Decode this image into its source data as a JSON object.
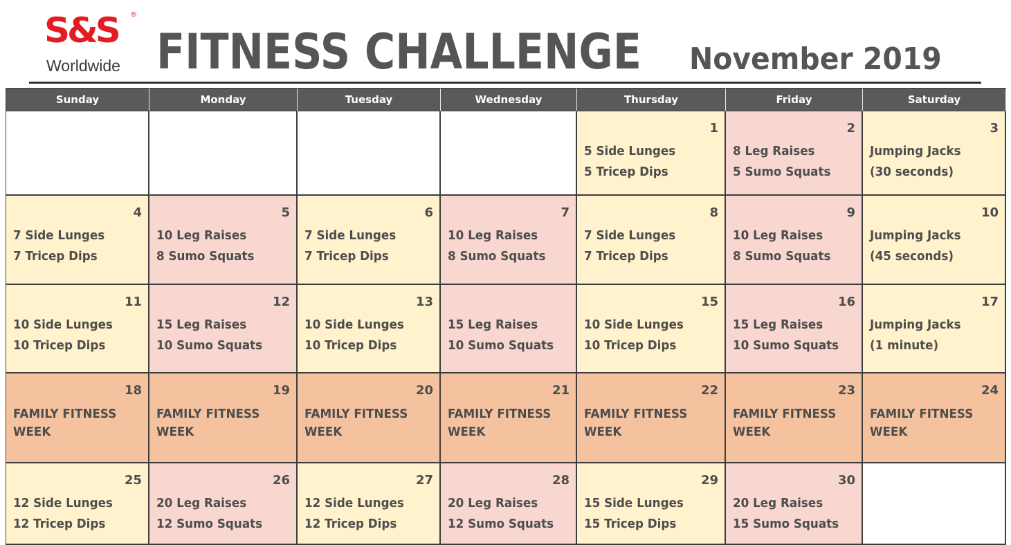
{
  "header": {
    "logo_mark": "S&S",
    "logo_reg": "®",
    "logo_sub": "Worldwide",
    "title": "FITNESS CHALLENGE",
    "month": "November 2019"
  },
  "days": [
    "Sunday",
    "Monday",
    "Tuesday",
    "Wednesday",
    "Thursday",
    "Friday",
    "Saturday"
  ],
  "colors": {
    "yellow": "#fff2cc",
    "pink": "#f8d7d0",
    "orange": "#f5c29f",
    "header": "#5a5a5a",
    "logo_red": "#e31b23"
  },
  "weeks": [
    [
      {
        "day": "",
        "l1": "",
        "l2": "",
        "color": "white"
      },
      {
        "day": "",
        "l1": "",
        "l2": "",
        "color": "white"
      },
      {
        "day": "",
        "l1": "",
        "l2": "",
        "color": "white"
      },
      {
        "day": "",
        "l1": "",
        "l2": "",
        "color": "white"
      },
      {
        "day": "1",
        "l1": "5 Side Lunges",
        "l2": "5 Tricep Dips",
        "color": "yellow"
      },
      {
        "day": "2",
        "l1": "8 Leg Raises",
        "l2": "5 Sumo Squats",
        "color": "pink"
      },
      {
        "day": "3",
        "l1": "Jumping Jacks",
        "l2": "(30 seconds)",
        "color": "yellow"
      }
    ],
    [
      {
        "day": "4",
        "l1": "7 Side Lunges",
        "l2": "7 Tricep Dips",
        "color": "yellow"
      },
      {
        "day": "5",
        "l1": "10 Leg Raises",
        "l2": "8 Sumo Squats",
        "color": "pink"
      },
      {
        "day": "6",
        "l1": "7 Side Lunges",
        "l2": "7 Tricep Dips",
        "color": "yellow"
      },
      {
        "day": "7",
        "l1": "10 Leg Raises",
        "l2": "8 Sumo Squats",
        "color": "pink"
      },
      {
        "day": "8",
        "l1": "7 Side Lunges",
        "l2": "7 Tricep Dips",
        "color": "yellow"
      },
      {
        "day": "9",
        "l1": "10 Leg Raises",
        "l2": "8 Sumo Squats",
        "color": "pink"
      },
      {
        "day": "10",
        "l1": "Jumping Jacks",
        "l2": "(45 seconds)",
        "color": "yellow"
      }
    ],
    [
      {
        "day": "11",
        "l1": "10 Side Lunges",
        "l2": "10 Tricep Dips",
        "color": "yellow"
      },
      {
        "day": "12",
        "l1": "15 Leg Raises",
        "l2": "10 Sumo Squats",
        "color": "pink"
      },
      {
        "day": "13",
        "l1": "10 Side Lunges",
        "l2": "10 Tricep Dips",
        "color": "yellow"
      },
      {
        "day": "",
        "l1": "15 Leg Raises",
        "l2": "10 Sumo Squats",
        "color": "pink"
      },
      {
        "day": "15",
        "l1": "10 Side Lunges",
        "l2": "10 Tricep Dips",
        "color": "yellow"
      },
      {
        "day": "16",
        "l1": "15 Leg Raises",
        "l2": "10 Sumo Squats",
        "color": "pink"
      },
      {
        "day": "17",
        "l1": "Jumping Jacks",
        "l2": "(1 minute)",
        "color": "yellow"
      }
    ],
    [
      {
        "day": "18",
        "l1": "FAMILY FITNESS",
        "l2": "WEEK",
        "color": "orange"
      },
      {
        "day": "19",
        "l1": "FAMILY FITNESS",
        "l2": "WEEK",
        "color": "orange"
      },
      {
        "day": "20",
        "l1": "FAMILY FITNESS",
        "l2": "WEEK",
        "color": "orange"
      },
      {
        "day": "21",
        "l1": "FAMILY FITNESS",
        "l2": "WEEK",
        "color": "orange"
      },
      {
        "day": "22",
        "l1": "FAMILY FITNESS",
        "l2": "WEEK",
        "color": "orange"
      },
      {
        "day": "23",
        "l1": "FAMILY FITNESS",
        "l2": "WEEK",
        "color": "orange"
      },
      {
        "day": "24",
        "l1": "FAMILY FITNESS",
        "l2": "WEEK",
        "color": "orange"
      }
    ],
    [
      {
        "day": "25",
        "l1": "12 Side Lunges",
        "l2": "12 Tricep Dips",
        "color": "yellow"
      },
      {
        "day": "26",
        "l1": "20 Leg Raises",
        "l2": "12 Sumo Squats",
        "color": "pink"
      },
      {
        "day": "27",
        "l1": "12 Side Lunges",
        "l2": "12 Tricep Dips",
        "color": "yellow"
      },
      {
        "day": "28",
        "l1": "20 Leg Raises",
        "l2": "12 Sumo Squats",
        "color": "pink"
      },
      {
        "day": "29",
        "l1": "15 Side Lunges",
        "l2": "15 Tricep Dips",
        "color": "yellow"
      },
      {
        "day": "30",
        "l1": "20 Leg Raises",
        "l2": "15 Sumo Squats",
        "color": "pink"
      },
      {
        "day": "",
        "l1": "",
        "l2": "",
        "color": "white"
      }
    ]
  ]
}
